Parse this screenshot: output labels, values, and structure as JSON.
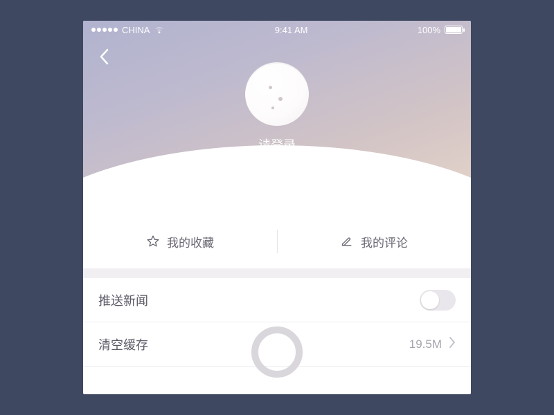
{
  "status": {
    "carrier": "CHINA",
    "time": "9:41 AM",
    "battery": "100%"
  },
  "profile": {
    "login_prompt": "请登录"
  },
  "quick": {
    "favorites": "我的收藏",
    "comments": "我的评论"
  },
  "settings": {
    "push_news": {
      "label": "推送新闻",
      "enabled": false
    },
    "clear_cache": {
      "label": "清空缓存",
      "value": "19.5M"
    }
  }
}
